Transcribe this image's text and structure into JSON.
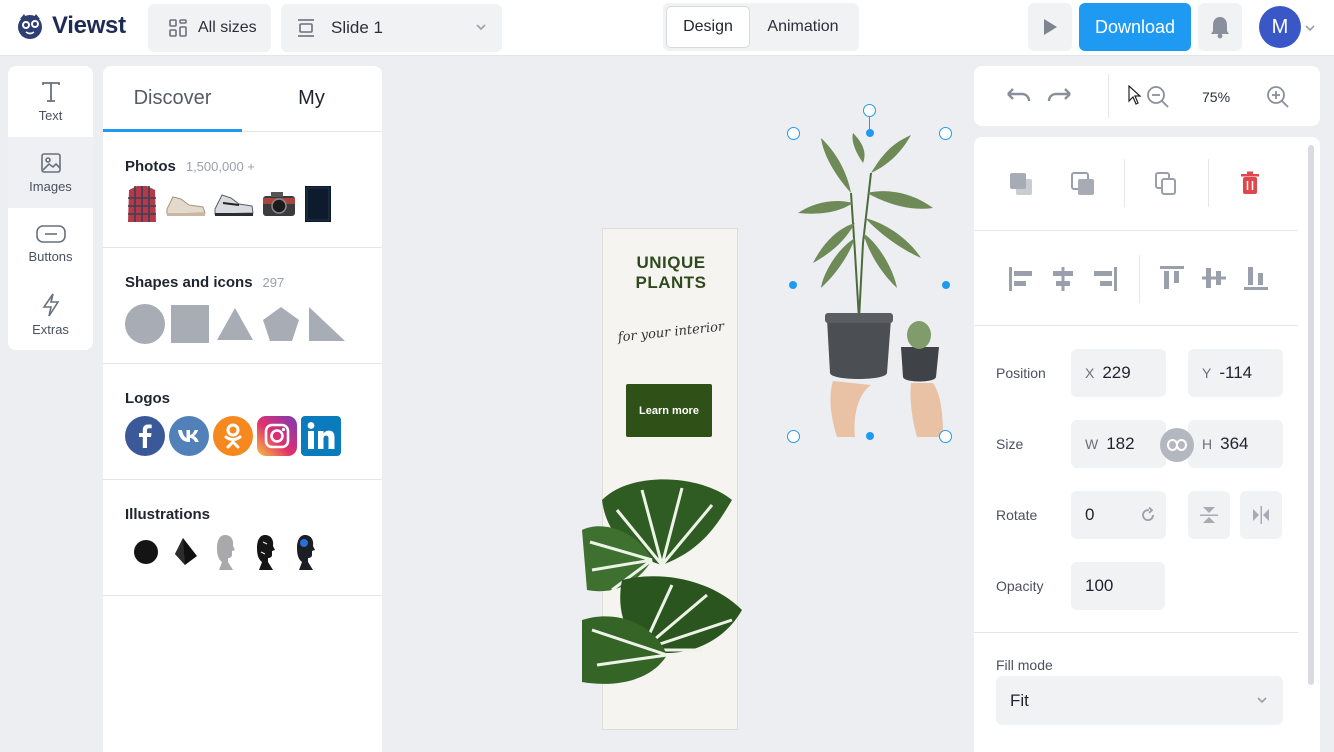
{
  "app": {
    "name": "Viewst"
  },
  "topbar": {
    "all_sizes_label": "All sizes",
    "slide_label": "Slide 1",
    "tabs": [
      {
        "label": "Design",
        "active": true
      },
      {
        "label": "Animation",
        "active": false
      }
    ],
    "download_label": "Download",
    "avatar_initial": "M"
  },
  "rail": {
    "items": [
      {
        "label": "Text",
        "icon": "text-icon",
        "active": false
      },
      {
        "label": "Images",
        "icon": "image-icon",
        "active": true
      },
      {
        "label": "Buttons",
        "icon": "button-icon",
        "active": false
      },
      {
        "label": "Extras",
        "icon": "lightning-icon",
        "active": false
      }
    ]
  },
  "library": {
    "tabs": [
      {
        "label": "Discover",
        "active": true
      },
      {
        "label": "My",
        "active": false
      }
    ],
    "sections": [
      {
        "title": "Photos",
        "count": "1,500,000 +"
      },
      {
        "title": "Shapes and icons",
        "count": "297"
      },
      {
        "title": "Logos",
        "count": ""
      },
      {
        "title": "Illustrations",
        "count": ""
      }
    ]
  },
  "artboard": {
    "title_line1": "UNIQUE",
    "title_line2": "PLANTS",
    "subtitle": "for your interior",
    "cta": "Learn more"
  },
  "zoom": {
    "value": "75%"
  },
  "properties": {
    "position_label": "Position",
    "x_axis": "X",
    "x": "229",
    "y_axis": "Y",
    "y": "-114",
    "size_label": "Size",
    "w_axis": "W",
    "w": "182",
    "h_axis": "H",
    "h": "364",
    "rotate_label": "Rotate",
    "rotate": "0",
    "opacity_label": "Opacity",
    "opacity": "100",
    "fill_mode_label": "Fill mode",
    "fill_mode": "Fit"
  },
  "colors": {
    "accent": "#1f9af2",
    "avatar": "#3a57c8",
    "delete": "#e0474c",
    "cta_green": "#2f5117"
  }
}
